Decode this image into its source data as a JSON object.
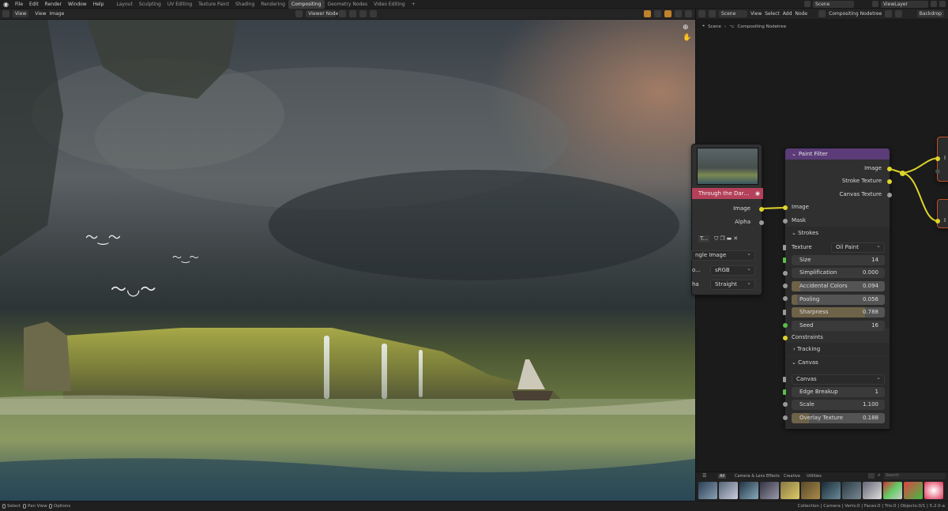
{
  "topbar": {
    "menus": [
      "File",
      "Edit",
      "Render",
      "Window",
      "Help"
    ],
    "workspaces": [
      "Layout",
      "Sculpting",
      "UV Editing",
      "Texture Paint",
      "Shading",
      "Rendering",
      "Compositing",
      "Geometry Nodes",
      "Video Editing"
    ],
    "active_workspace": "Compositing",
    "add_tab": "+",
    "scene": "Scene",
    "view_layer": "ViewLayer"
  },
  "left_header": {
    "view_dropdown": "View",
    "view": "View",
    "image": "Image",
    "viewer_node": "Viewer Node"
  },
  "right_header": {
    "scene": "Scene",
    "view": "View",
    "select": "Select",
    "add": "Add",
    "node": "Node",
    "nodetree": "Compositing Nodetree",
    "backdrop": "Backdrop"
  },
  "breadcrumb": {
    "scene": "Scene",
    "nodetree": "Compositing Nodetree"
  },
  "image_node": {
    "title": "Through the Dar…",
    "output_image": "Image",
    "output_alpha": "Alpha",
    "source": "ngle Image",
    "colorspace_label": "o...",
    "colorspace": "sRGB",
    "alpha_label": "ha",
    "alpha_mode": "Straight",
    "toolbar_text": "T..."
  },
  "paint_filter": {
    "title": "Paint Filter",
    "outputs": [
      "Image",
      "Stroke Texture",
      "Canvas Texture"
    ],
    "inputs": [
      "Image",
      "Mask"
    ],
    "strokes_panel": "Strokes",
    "texture_label": "Texture",
    "texture_value": "Oil Paint",
    "size_label": "Size",
    "size_value": "14",
    "simplification_label": "Simplification",
    "simplification_value": "0.000",
    "accidental_label": "Accidental Colors",
    "accidental_value": "0.094",
    "accidental_fraction": 0.094,
    "pooling_label": "Pooling",
    "pooling_value": "0.056",
    "pooling_fraction": 0.056,
    "sharpness_label": "Sharpness",
    "sharpness_value": "0.788",
    "sharpness_fraction": 0.788,
    "seed_label": "Seed",
    "seed_value": "16",
    "constraints_label": "Constraints",
    "tracking_panel": "Tracking",
    "canvas_panel": "Canvas",
    "canvas_dropdown": "Canvas",
    "edge_label": "Edge Breakup",
    "edge_value": "1",
    "scale_label": "Scale",
    "scale_value": "1.100",
    "overlay_label": "Overlay Texture",
    "overlay_value": "0.188",
    "overlay_fraction": 0.188
  },
  "right_nodes": {
    "socket_label_1": "I",
    "socket_label_2": "I"
  },
  "shelf": {
    "tabs": [
      "All",
      "Camera & Lens Effects",
      "Creative",
      "Utilities"
    ],
    "search_placeholder": "Search"
  },
  "statusbar": {
    "select": "Select",
    "pan": "Pan View",
    "options": "Options",
    "stats": "Collection | Camera | Verts:0 | Faces:0 | Tris:0 | Objects:0/1 | 5.2.0-a"
  },
  "colors": {
    "paint_filter_header": "#5b3b78",
    "image_node_header": "#b4405a",
    "socket_image": "#dfd52c",
    "socket_value": "#9a9a9a",
    "socket_int": "#5bbd4b",
    "output_node_border": "#c0502a"
  }
}
